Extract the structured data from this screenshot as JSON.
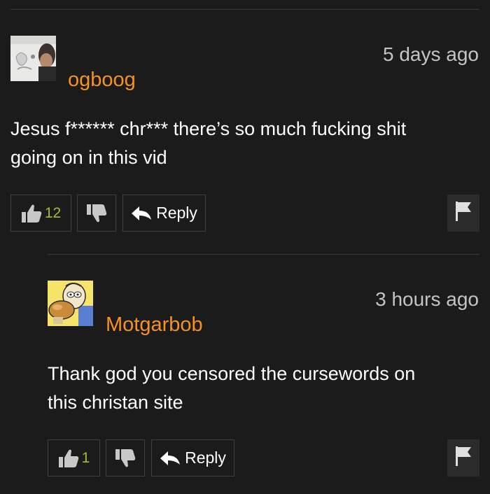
{
  "comments": [
    {
      "username": "ogboog",
      "time": "5 days ago",
      "text_lines": [
        "Jesus f****** chr*** there’s so much fucking shit",
        "going on in this vid"
      ],
      "likes": "12",
      "reply_label": "Reply"
    },
    {
      "username": "Motgarbob",
      "time": "3 hours ago",
      "text_lines": [
        "Thank god you censored the cursewords on",
        "this christan site"
      ],
      "likes": "1",
      "reply_label": "Reply"
    }
  ],
  "colors": {
    "background": "#1b1b1b",
    "username": "#f6921e",
    "like_count": "#9fbf31",
    "timestamp": "#c4c4c4",
    "button_border": "#3f3f3f",
    "flag_button": "#2c2c2c"
  },
  "icons": [
    "thumbs-up-icon",
    "thumbs-down-icon",
    "reply-arrow-icon",
    "flag-icon"
  ]
}
